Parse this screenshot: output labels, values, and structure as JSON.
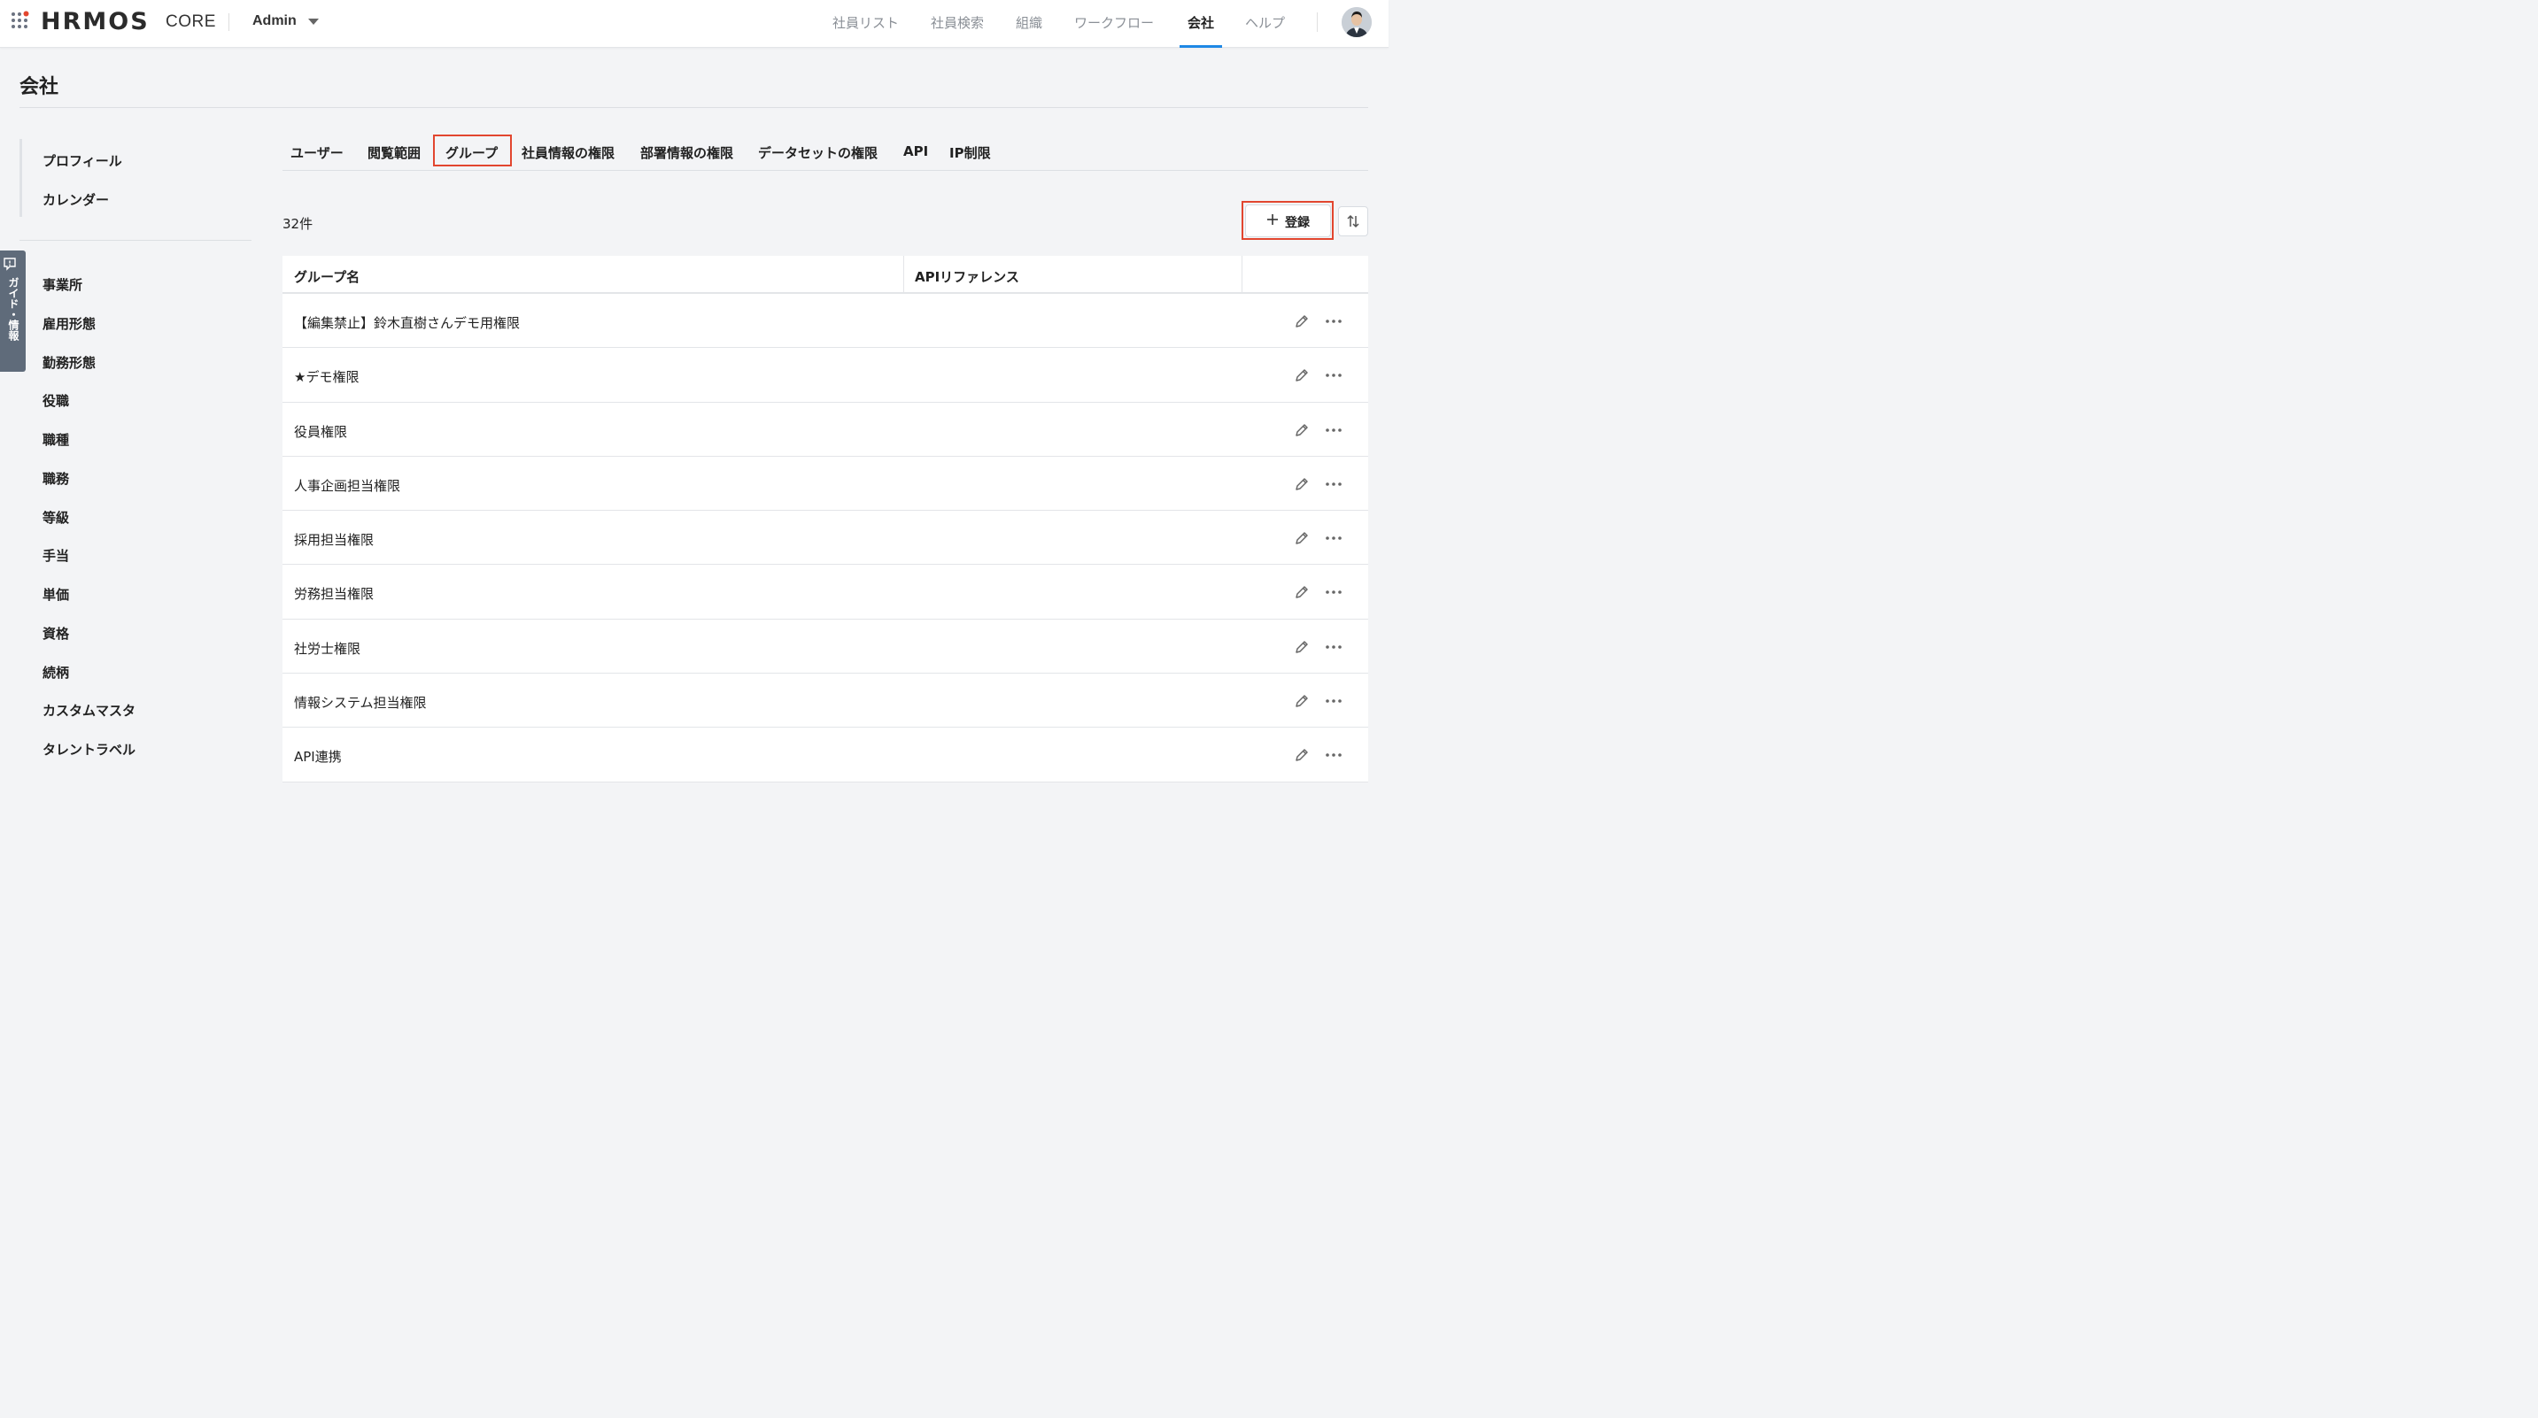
{
  "header": {
    "brand": "HRMOS",
    "product": "CORE",
    "role": "Admin",
    "nav": [
      {
        "label": "社員リスト"
      },
      {
        "label": "社員検索"
      },
      {
        "label": "組織"
      },
      {
        "label": "ワークフロー"
      },
      {
        "label": "会社",
        "active": true
      },
      {
        "label": "ヘルプ"
      }
    ]
  },
  "page": {
    "title": "会社"
  },
  "guide_tab": {
    "label": "ガイド・情報"
  },
  "sidebar": {
    "group1": [
      "プロフィール",
      "カレンダー"
    ],
    "group2": [
      "事業所",
      "雇用形態",
      "勤務形態",
      "役職",
      "職種",
      "職務",
      "等級",
      "手当",
      "単価",
      "資格",
      "続柄",
      "カスタムマスタ",
      "タレントラベル"
    ]
  },
  "tabs": [
    {
      "label": "ユーザー"
    },
    {
      "label": "閲覧範囲"
    },
    {
      "label": "グループ",
      "active": true
    },
    {
      "label": "社員情報の権限"
    },
    {
      "label": "部署情報の権限"
    },
    {
      "label": "データセットの権限"
    },
    {
      "label": "API"
    },
    {
      "label": "IP制限"
    }
  ],
  "list": {
    "count_label": "32件",
    "add_button": "登録",
    "columns": [
      "グループ名",
      "APIリファレンス"
    ],
    "rows": [
      {
        "name": "【編集禁止】鈴木直樹さんデモ用権限",
        "api_code": ""
      },
      {
        "name": "★デモ権限",
        "api_code": ""
      },
      {
        "name": "役員権限",
        "api_code": ""
      },
      {
        "name": "人事企画担当権限",
        "api_code": ""
      },
      {
        "name": "採用担当権限",
        "api_code": ""
      },
      {
        "name": "労務担当権限",
        "api_code": ""
      },
      {
        "name": "社労士権限",
        "api_code": ""
      },
      {
        "name": "情報システム担当権限",
        "api_code": ""
      },
      {
        "name": "API連携",
        "api_code": ""
      }
    ]
  },
  "colors": {
    "accent": "#1e88e5",
    "highlight": "#e2462f",
    "guide_tab": "#5f6b7a",
    "background": "#f3f4f6"
  }
}
